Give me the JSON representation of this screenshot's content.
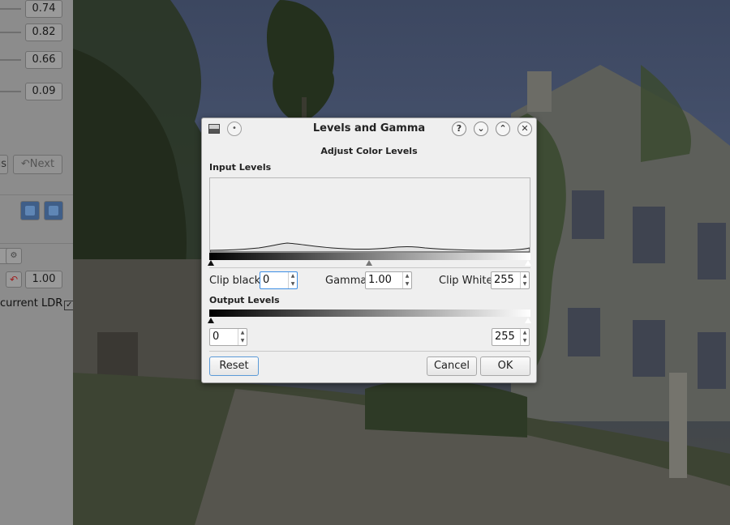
{
  "left_panel": {
    "values": [
      "0.74",
      "0.82",
      "0.66",
      "0.09"
    ],
    "prev_label": "us",
    "next_label": "Next",
    "gamma_value": "1.00",
    "ldr_label": "current LDR",
    "ldr_checked_glyph": "✓"
  },
  "dialog": {
    "title": "Levels and Gamma",
    "subtitle": "Adjust Color Levels",
    "titlebar_buttons": [
      "?",
      "⌄",
      "⌃",
      "✕"
    ],
    "input_section": "Input Levels",
    "output_section": "Output Levels",
    "clip_black_label": "Clip black",
    "clip_black_value": "0",
    "gamma_label": "Gamma",
    "gamma_value": "1.00",
    "clip_white_label": "Clip White",
    "clip_white_value": "255",
    "output_black_value": "0",
    "output_white_value": "255",
    "reset_label": "Reset",
    "cancel_label": "Cancel",
    "ok_label": "OK"
  },
  "colors": {
    "dialog_bg": "#efefef",
    "focus_border": "#3d8ee5",
    "default_button_border": "#5b9ad8"
  },
  "icons": [
    "window-app-icon",
    "pin-icon",
    "help-icon",
    "minimize-icon",
    "maximize-icon",
    "close-icon",
    "undo-icon",
    "settings-icon",
    "checkbox-checked-icon"
  ]
}
